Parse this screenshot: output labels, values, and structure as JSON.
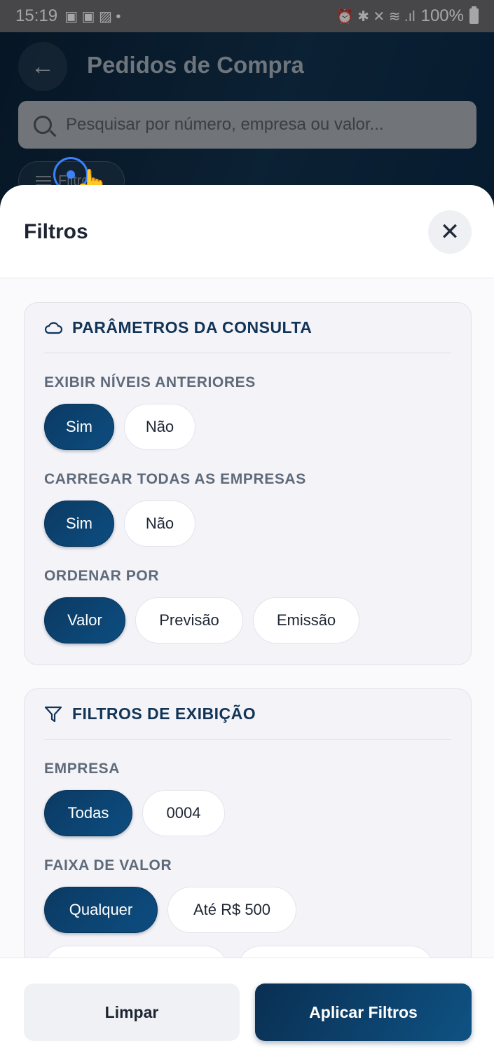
{
  "status_bar": {
    "time": "15:19",
    "battery": "100%"
  },
  "header": {
    "title": "Pedidos de Compra",
    "search_placeholder": "Pesquisar por número, empresa ou valor...",
    "filters_chip_label": "Filtros"
  },
  "sheet": {
    "title": "Filtros",
    "close_label": "✕",
    "consulta": {
      "title": "PARÂMETROS DA CONSULTA",
      "niveis": {
        "label": "EXIBIR NÍVEIS ANTERIORES",
        "options": [
          "Sim",
          "Não"
        ],
        "selected": "Sim"
      },
      "empresas": {
        "label": "CARREGAR TODAS AS EMPRESAS",
        "options": [
          "Sim",
          "Não"
        ],
        "selected": "Sim"
      },
      "ordenar": {
        "label": "ORDENAR POR",
        "options": [
          "Valor",
          "Previsão",
          "Emissão"
        ],
        "selected": "Valor"
      }
    },
    "exibicao": {
      "title": "FILTROS DE EXIBIÇÃO",
      "empresa": {
        "label": "EMPRESA",
        "options": [
          "Todas",
          "0004"
        ],
        "selected": "Todas"
      },
      "faixa": {
        "label": "FAIXA DE VALOR",
        "options": [
          "Qualquer",
          "Até R$ 500"
        ],
        "selected": "Qualquer"
      }
    },
    "footer": {
      "clear_label": "Limpar",
      "apply_label": "Aplicar Filtros"
    }
  },
  "colors": {
    "primary": "#0b3a63",
    "header_bg": "#0a2239",
    "card_bg": "#f3f3f8"
  }
}
